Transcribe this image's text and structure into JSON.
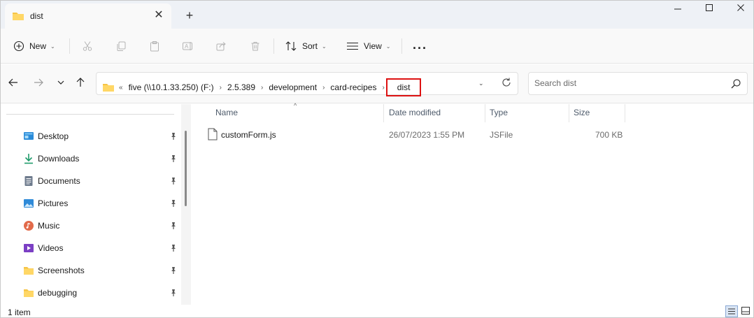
{
  "tab": {
    "title": "dist",
    "close_glyph": "✕",
    "new_tab_glyph": "+"
  },
  "window_controls": {
    "minimize": "—",
    "maximize": "☐",
    "close": "✕"
  },
  "toolbar": {
    "new_label": "New",
    "sort_label": "Sort",
    "view_label": "View",
    "more_glyph": "···",
    "caret": "⌄",
    "icons": [
      "add-icon",
      "cut-icon",
      "copy-icon",
      "paste-icon",
      "rename-icon",
      "share-icon",
      "delete-icon",
      "sort-icon",
      "view-icon",
      "more-icon"
    ]
  },
  "nav": {
    "back": "←",
    "forward": "→",
    "recent": "⌄",
    "up": "↑"
  },
  "address": {
    "overflow": "«",
    "crumbs": [
      "five (\\\\10.1.33.250) (F:)",
      "2.5.389",
      "development",
      "card-recipes"
    ],
    "current": "dist",
    "separator": "›",
    "dropdown_glyph": "⌄",
    "highlight_color": "#dd1111"
  },
  "search": {
    "placeholder": "Search dist"
  },
  "sidebar": {
    "items": [
      {
        "label": "Desktop",
        "icon": "desktop-icon"
      },
      {
        "label": "Downloads",
        "icon": "download-icon"
      },
      {
        "label": "Documents",
        "icon": "documents-icon"
      },
      {
        "label": "Pictures",
        "icon": "pictures-icon"
      },
      {
        "label": "Music",
        "icon": "music-icon"
      },
      {
        "label": "Videos",
        "icon": "videos-icon"
      },
      {
        "label": "Screenshots",
        "icon": "folder-icon"
      },
      {
        "label": "debugging",
        "icon": "folder-icon"
      }
    ]
  },
  "columns": {
    "name": "Name",
    "date": "Date modified",
    "type": "Type",
    "size": "Size",
    "sort_glyph": "^"
  },
  "files": [
    {
      "name": "customForm.js",
      "date": "26/07/2023 1:55 PM",
      "type": "JSFile",
      "size": "700 KB"
    }
  ],
  "status": {
    "count": "1 item"
  },
  "colors": {
    "accent": "#0067c0",
    "folder": "#f6c445",
    "titlebar": "#eef1f6",
    "toolbar": "#f9f9f9"
  }
}
